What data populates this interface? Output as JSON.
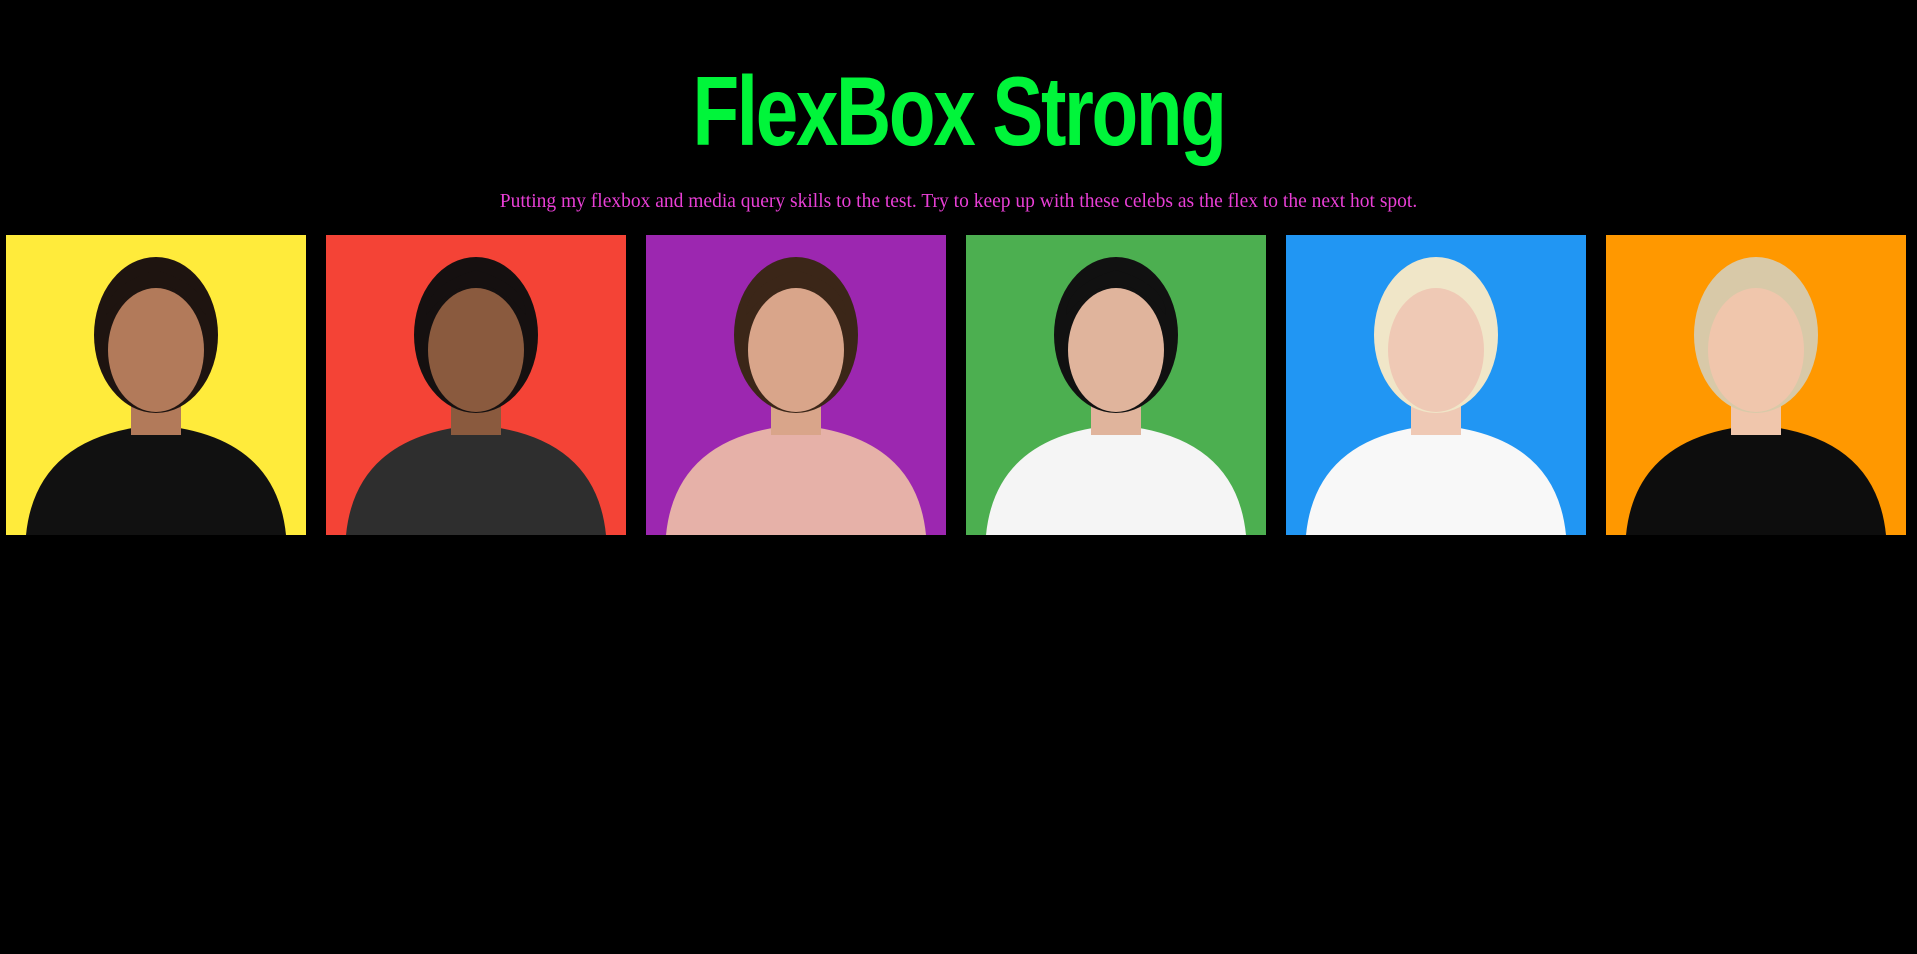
{
  "header": {
    "title": "FlexBox Strong",
    "subtitle": "Putting my flexbox and media query skills to the test. Try to keep up with these celebs as the flex to the next hot spot."
  },
  "colors": {
    "background": "#000000",
    "title": "#00f53a",
    "subtitle": "#e93fd6"
  },
  "gallery": [
    {
      "bg": "#ffeb3b",
      "skin": "#b27a5a",
      "hair": "#1e1410",
      "outfit": "#111111"
    },
    {
      "bg": "#f44336",
      "skin": "#8a5a3e",
      "hair": "#151010",
      "outfit": "#2e2e2e"
    },
    {
      "bg": "#9c27b0",
      "skin": "#d9a58a",
      "hair": "#3b2618",
      "outfit": "#e6b1a8"
    },
    {
      "bg": "#4caf50",
      "skin": "#e0b49c",
      "hair": "#111111",
      "outfit": "#f5f5f5"
    },
    {
      "bg": "#2196f3",
      "skin": "#efc9b5",
      "hair": "#f0e6c8",
      "outfit": "#f8f8f8"
    },
    {
      "bg": "#ff9800",
      "skin": "#f0c6ac",
      "hair": "#d8c9a8",
      "outfit": "#0d0d0d"
    }
  ]
}
